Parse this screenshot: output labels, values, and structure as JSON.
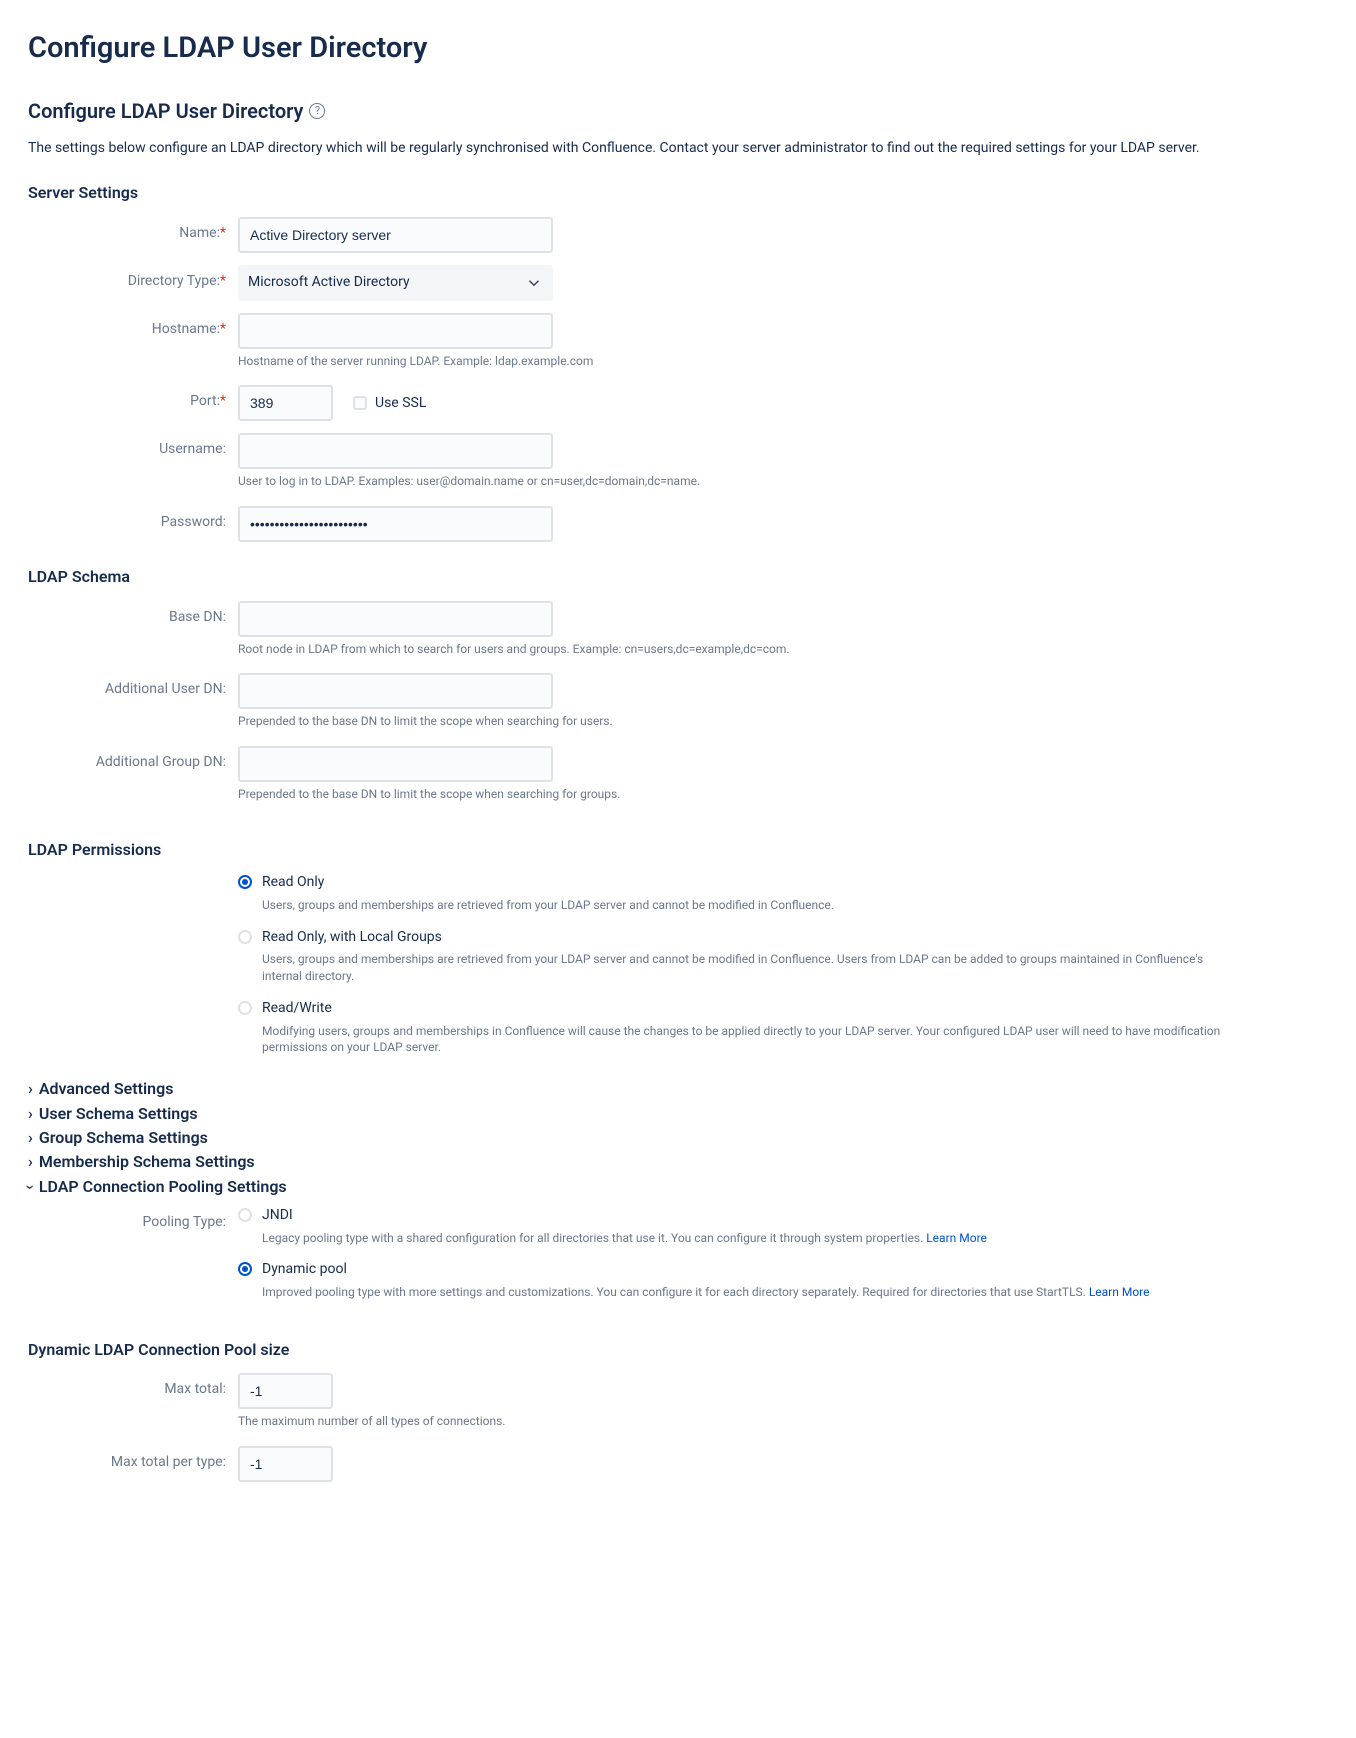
{
  "page": {
    "title": "Configure LDAP User Directory",
    "subtitle": "Configure LDAP User Directory",
    "description": "The settings below configure an LDAP directory which will be regularly synchronised with Confluence. Contact your server administrator to find out the required settings for your LDAP server."
  },
  "sections": {
    "server": {
      "heading": "Server Settings"
    },
    "schema": {
      "heading": "LDAP Schema"
    },
    "permissions": {
      "heading": "LDAP Permissions"
    },
    "poolsize": {
      "heading": "Dynamic LDAP Connection Pool size"
    }
  },
  "fields": {
    "name": {
      "label": "Name:",
      "value": "Active Directory server"
    },
    "directoryType": {
      "label": "Directory Type:",
      "value": "Microsoft Active Directory"
    },
    "hostname": {
      "label": "Hostname:",
      "value": "",
      "help": "Hostname of the server running LDAP. Example: ldap.example.com"
    },
    "port": {
      "label": "Port:",
      "value": "389"
    },
    "useSsl": {
      "label": "Use SSL"
    },
    "username": {
      "label": "Username:",
      "value": "",
      "help": "User to log in to LDAP. Examples: user@domain.name or cn=user,dc=domain,dc=name."
    },
    "password": {
      "label": "Password:",
      "value": "••••••••••••••••••••••••"
    },
    "baseDn": {
      "label": "Base DN:",
      "value": "",
      "help": "Root node in LDAP from which to search for users and groups. Example: cn=users,dc=example,dc=com."
    },
    "addUserDn": {
      "label": "Additional User DN:",
      "value": "",
      "help": "Prepended to the base DN to limit the scope when searching for users."
    },
    "addGroupDn": {
      "label": "Additional Group DN:",
      "value": "",
      "help": "Prepended to the base DN to limit the scope when searching for groups."
    },
    "poolingType": {
      "label": "Pooling Type:"
    },
    "maxTotal": {
      "label": "Max total:",
      "value": "-1",
      "help": "The maximum number of all types of connections."
    },
    "maxTotalPerType": {
      "label": "Max total per type:",
      "value": "-1"
    }
  },
  "permissions": {
    "readOnly": {
      "label": "Read Only",
      "desc": "Users, groups and memberships are retrieved from your LDAP server and cannot be modified in Confluence."
    },
    "readOnlyLocal": {
      "label": "Read Only, with Local Groups",
      "desc": "Users, groups and memberships are retrieved from your LDAP server and cannot be modified in Confluence. Users from LDAP can be added to groups maintained in Confluence's internal directory."
    },
    "readWrite": {
      "label": "Read/Write",
      "desc": "Modifying users, groups and memberships in Confluence will cause the changes to be applied directly to your LDAP server. Your configured LDAP user will need to have modification permissions on your LDAP server."
    }
  },
  "collapsibles": {
    "advanced": "Advanced Settings",
    "userSchema": "User Schema Settings",
    "groupSchema": "Group Schema Settings",
    "membershipSchema": "Membership Schema Settings",
    "ldapPooling": "LDAP Connection Pooling Settings"
  },
  "pooling": {
    "jndi": {
      "label": "JNDI",
      "desc": "Legacy pooling type with a shared configuration for all directories that use it. You can configure it through system properties. ",
      "link": "Learn More"
    },
    "dynamic": {
      "label": "Dynamic pool",
      "desc": "Improved pooling type with more settings and customizations. You can configure it for each directory separately. Required for directories that use StartTLS. ",
      "link": "Learn More"
    }
  }
}
